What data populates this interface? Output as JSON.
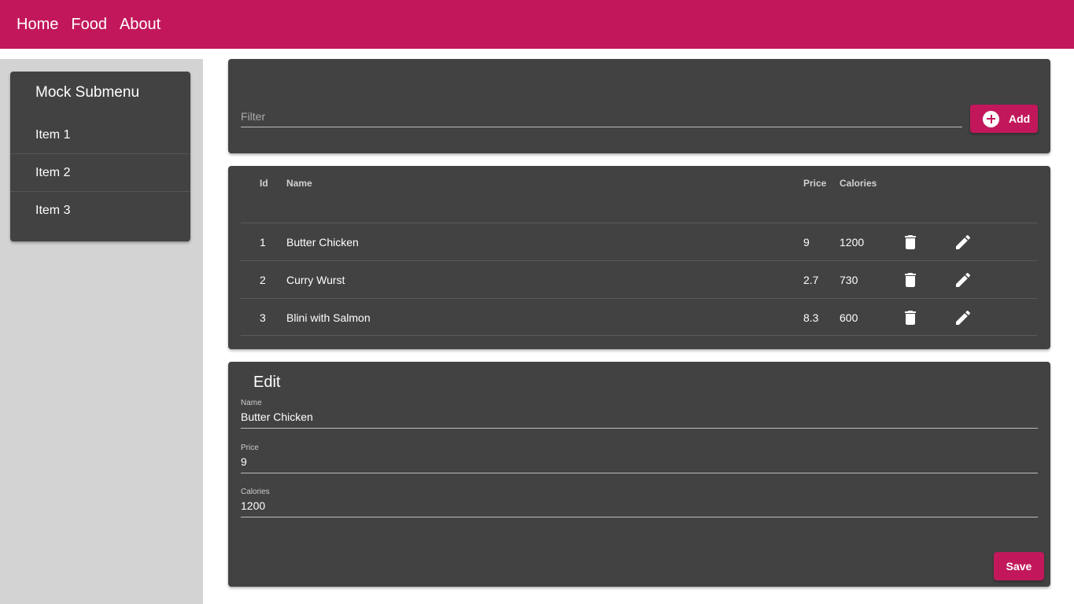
{
  "nav": {
    "items": [
      "Home",
      "Food",
      "About"
    ]
  },
  "submenu": {
    "title": "Mock Submenu",
    "items": [
      "Item 1",
      "Item 2",
      "Item 3"
    ]
  },
  "filter": {
    "placeholder": "Filter",
    "value": ""
  },
  "add_button": {
    "label": "Add",
    "icon": "add-circle-icon"
  },
  "table": {
    "headers": {
      "id": "Id",
      "name": "Name",
      "price": "Price",
      "calories": "Calories"
    },
    "rows": [
      {
        "id": "1",
        "name": "Butter Chicken",
        "price": "9",
        "calories": "1200"
      },
      {
        "id": "2",
        "name": "Curry Wurst",
        "price": "2.7",
        "calories": "730"
      },
      {
        "id": "3",
        "name": "Blini with Salmon",
        "price": "8.3",
        "calories": "600"
      }
    ],
    "row_actions": [
      "delete-icon",
      "edit-pencil-icon"
    ]
  },
  "edit": {
    "title": "Edit",
    "fields": {
      "name": {
        "label": "Name",
        "value": "Butter Chicken"
      },
      "price": {
        "label": "Price",
        "value": "9"
      },
      "calories": {
        "label": "Calories",
        "value": "1200"
      }
    },
    "save_label": "Save"
  },
  "colors": {
    "primary": "#c2185b",
    "card": "#424242",
    "sidebar": "#d3d3d3"
  }
}
